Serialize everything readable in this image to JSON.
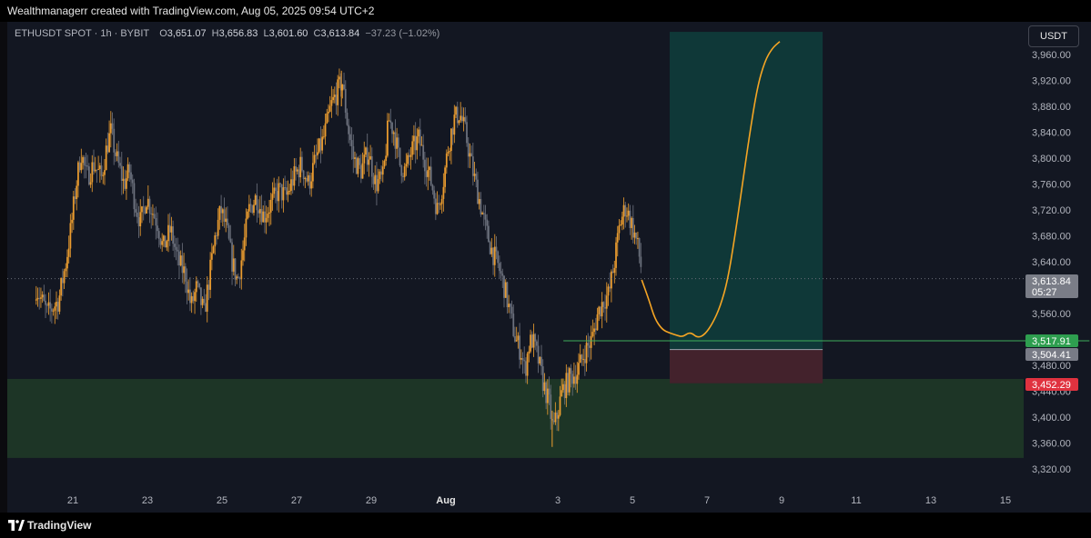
{
  "caption": "Wealthmanagerr created with TradingView.com, Aug 05, 2025 09:54 UTC+2",
  "legend": {
    "symbol": "ETHUSDT SPOT · 1h · BYBIT",
    "open_label": "O",
    "open": "3,651.07",
    "high_label": "H",
    "high": "3,656.83",
    "low_label": "L",
    "low": "3,601.60",
    "close_label": "C",
    "close": "3,613.84",
    "change": "−37.23 (−1.02%)"
  },
  "currency": "USDT",
  "footer": {
    "brand": "TradingView",
    "logo_icon": "tradingview-logo-icon"
  },
  "colors": {
    "background": "#131722",
    "candle_up": "#f0a030",
    "candle_down": "#6f7480",
    "projection": "#f5a524",
    "demand_zone": "#1d3526",
    "target_zone": "#0f3a3a",
    "stop_zone": "#43222c",
    "entry_line": "#3fae5a",
    "tag_current": "#7a7d87",
    "tag_entry": "#2e9e4f",
    "tag_level": "#787b86",
    "tag_stop": "#e0323f"
  },
  "chart_data": {
    "type": "candlestick",
    "timeframe": "1h",
    "x_ticks": [
      "21",
      "23",
      "25",
      "27",
      "29",
      "Aug",
      "3",
      "5",
      "7",
      "9",
      "11",
      "13",
      "15"
    ],
    "y_ticks": [
      "3,320.00",
      "3,360.00",
      "3,400.00",
      "3,440.00",
      "3,480.00",
      "3,520.00",
      "3,560.00",
      "3,600.00",
      "3,640.00",
      "3,680.00",
      "3,720.00",
      "3,760.00",
      "3,800.00",
      "3,840.00",
      "3,880.00",
      "3,920.00",
      "3,960.00"
    ],
    "ylim": [
      3300,
      4000
    ],
    "price_path": [
      [
        20.0,
        3600
      ],
      [
        20.3,
        3560
      ],
      [
        20.6,
        3580
      ],
      [
        20.8,
        3640
      ],
      [
        20.95,
        3700
      ],
      [
        21.05,
        3750
      ],
      [
        21.2,
        3810
      ],
      [
        21.35,
        3770
      ],
      [
        21.55,
        3790
      ],
      [
        21.75,
        3770
      ],
      [
        21.9,
        3820
      ],
      [
        22.0,
        3840
      ],
      [
        22.15,
        3800
      ],
      [
        22.35,
        3760
      ],
      [
        22.5,
        3780
      ],
      [
        22.65,
        3730
      ],
      [
        22.8,
        3700
      ],
      [
        22.95,
        3740
      ],
      [
        23.1,
        3720
      ],
      [
        23.25,
        3700
      ],
      [
        23.4,
        3660
      ],
      [
        23.6,
        3690
      ],
      [
        23.8,
        3640
      ],
      [
        24.0,
        3620
      ],
      [
        24.15,
        3570
      ],
      [
        24.3,
        3600
      ],
      [
        24.5,
        3560
      ],
      [
        24.65,
        3620
      ],
      [
        24.8,
        3680
      ],
      [
        24.95,
        3720
      ],
      [
        25.1,
        3690
      ],
      [
        25.25,
        3640
      ],
      [
        25.4,
        3610
      ],
      [
        25.55,
        3660
      ],
      [
        25.7,
        3720
      ],
      [
        25.9,
        3740
      ],
      [
        26.1,
        3710
      ],
      [
        26.3,
        3730
      ],
      [
        26.5,
        3750
      ],
      [
        26.7,
        3740
      ],
      [
        26.9,
        3770
      ],
      [
        27.1,
        3790
      ],
      [
        27.3,
        3760
      ],
      [
        27.5,
        3800
      ],
      [
        27.7,
        3830
      ],
      [
        27.9,
        3880
      ],
      [
        28.05,
        3900
      ],
      [
        28.2,
        3920
      ],
      [
        28.35,
        3850
      ],
      [
        28.5,
        3800
      ],
      [
        28.7,
        3780
      ],
      [
        28.9,
        3810
      ],
      [
        29.1,
        3760
      ],
      [
        29.3,
        3770
      ],
      [
        29.45,
        3860
      ],
      [
        29.6,
        3840
      ],
      [
        29.75,
        3790
      ],
      [
        29.9,
        3780
      ],
      [
        30.05,
        3810
      ],
      [
        30.25,
        3830
      ],
      [
        30.45,
        3790
      ],
      [
        30.6,
        3760
      ],
      [
        30.75,
        3720
      ],
      [
        30.9,
        3760
      ],
      [
        31.05,
        3820
      ],
      [
        31.2,
        3860
      ],
      [
        31.35,
        3870
      ],
      [
        31.5,
        3840
      ],
      [
        31.7,
        3780
      ],
      [
        31.9,
        3730
      ],
      [
        32.05,
        3690
      ],
      [
        32.2,
        3660
      ],
      [
        32.4,
        3630
      ],
      [
        32.55,
        3600
      ],
      [
        32.7,
        3560
      ],
      [
        32.85,
        3520
      ],
      [
        33.0,
        3500
      ],
      [
        33.1,
        3470
      ],
      [
        33.2,
        3510
      ],
      [
        33.3,
        3520
      ],
      [
        33.45,
        3490
      ],
      [
        33.6,
        3450
      ],
      [
        33.75,
        3420
      ],
      [
        33.85,
        3380
      ],
      [
        33.95,
        3400
      ],
      [
        34.1,
        3440
      ],
      [
        34.3,
        3460
      ],
      [
        34.5,
        3470
      ],
      [
        34.7,
        3500
      ],
      [
        34.9,
        3520
      ],
      [
        35.05,
        3560
      ],
      [
        35.2,
        3580
      ],
      [
        35.35,
        3590
      ],
      [
        35.5,
        3640
      ],
      [
        35.65,
        3700
      ],
      [
        35.8,
        3725
      ],
      [
        35.95,
        3700
      ],
      [
        36.1,
        3670
      ],
      [
        36.25,
        3620
      ]
    ],
    "price_annotations": {
      "high_wick": 3935,
      "low_wick": 3354,
      "first_open": 3580
    },
    "projection_path": [
      [
        36.25,
        3612
      ],
      [
        36.45,
        3580
      ],
      [
        36.6,
        3552
      ],
      [
        36.8,
        3535
      ],
      [
        37.0,
        3530
      ],
      [
        37.2,
        3526
      ],
      [
        37.35,
        3524
      ],
      [
        37.55,
        3532
      ],
      [
        37.75,
        3522
      ],
      [
        37.95,
        3528
      ],
      [
        38.15,
        3545
      ],
      [
        38.35,
        3570
      ],
      [
        38.55,
        3610
      ],
      [
        38.75,
        3680
      ],
      [
        38.95,
        3760
      ],
      [
        39.15,
        3840
      ],
      [
        39.35,
        3910
      ],
      [
        39.55,
        3950
      ],
      [
        39.75,
        3970
      ],
      [
        39.95,
        3980
      ]
    ],
    "demand_zone": {
      "x_from": 20.0,
      "x_to": 46.3,
      "y_from": 3337,
      "y_to": 3459
    },
    "long_position": {
      "x_from": 37.0,
      "x_to": 41.1,
      "entry": 3504.41,
      "target": 3995,
      "stop": 3452.29
    },
    "entry_line": {
      "x_from": 34.15,
      "x_to": 46.3,
      "y": 3517.91
    },
    "current_price_line": 3613.84,
    "price_tags": [
      {
        "label": "3,613.84",
        "sub": "05:27",
        "y": 3613.84,
        "role": "current"
      },
      {
        "label": "3,517.91",
        "sub": "",
        "y": 3517.91,
        "role": "entry"
      },
      {
        "label": "3,504.41",
        "sub": "",
        "y": 3504.41,
        "role": "level"
      },
      {
        "label": "3,452.29",
        "sub": "",
        "y": 3452.29,
        "role": "stop"
      }
    ]
  }
}
